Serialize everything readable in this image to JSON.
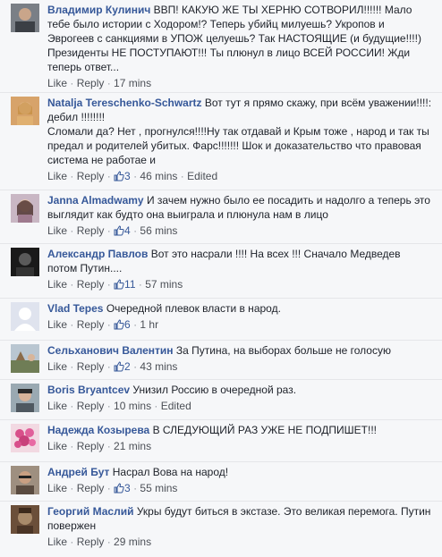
{
  "labels": {
    "like": "Like",
    "reply": "Reply",
    "sep": " · "
  },
  "colors": {
    "link": "#365899",
    "meta": "#90949c",
    "text": "#1d2129",
    "bg": "#f6f7f9"
  },
  "comments": [
    {
      "author": "Владимир Кулинич",
      "text": "ВВП! КАКУЮ ЖЕ ТЫ ХЕРНЮ СОТВОРИЛ!!!!!! Мало тебе было истории с Ходором!? Теперь убийц милуешь? Укропов и Эврогеев с санкциями в УПОЖ целуешь? Так НАСТОЯЩИЕ (и будущие!!!!) Президенты НЕ ПОСТУПАЮТ!!! Ты плюнул в лицо ВСЕЙ РОССИИ! Жди теперь ответ...",
      "likes": "",
      "time": "17 mins",
      "edited": "",
      "avatar_icon": "user-photo-icon"
    },
    {
      "author": "Natalja Tereschenko-Schwartz",
      "text": "Вот тут я прямо скажу, при всём уважении!!!!: дебил !!!!!!!!\nСломали да? Нет , прогнулся!!!!Ну так отдавай и Крым тоже , народ и так ты предал и родителей убитых. Фарс!!!!!!! Шок и доказательство что правовая система не работае и",
      "likes": "3",
      "time": "46 mins",
      "edited": "Edited",
      "avatar_icon": "user-photo-icon"
    },
    {
      "author": "Janna Almadwamy",
      "text": "И зачем нужно было ее посадить и надолго а теперь это выглядит как будто она выиграла и плюнула нам в лицо",
      "likes": "4",
      "time": "56 mins",
      "edited": "",
      "avatar_icon": "user-photo-icon"
    },
    {
      "author": "Александр Павлов",
      "text": "Вот это насрали !!!! На всех !!! Сначало Медведев потом Путин....",
      "likes": "11",
      "time": "57 mins",
      "edited": "",
      "avatar_icon": "user-photo-icon"
    },
    {
      "author": "Vlad Tepes",
      "text": "Очередной плевок власти в народ.",
      "likes": "6",
      "time": "1 hr",
      "edited": "",
      "avatar_icon": "default-avatar-icon"
    },
    {
      "author": "Сельханович Валентин",
      "text": "За Путина, на выборах больше не голосую",
      "likes": "2",
      "time": "43 mins",
      "edited": "",
      "avatar_icon": "user-photo-icon"
    },
    {
      "author": "Boris Bryantcev",
      "text": "Унизил Россию в очередной раз.",
      "likes": "",
      "time": "10 mins",
      "edited": "Edited",
      "avatar_icon": "user-photo-icon"
    },
    {
      "author": "Надежда Козырева",
      "text": "В СЛЕДУЮЩИЙ РАЗ УЖЕ НЕ ПОДПИШЕТ!!!",
      "likes": "",
      "time": "21 mins",
      "edited": "",
      "avatar_icon": "flowers-icon"
    },
    {
      "author": "Андрей Бут",
      "text": "Насрал Вова на народ!",
      "likes": "3",
      "time": "55 mins",
      "edited": "",
      "avatar_icon": "user-photo-icon"
    },
    {
      "author": "Георгий Маслий",
      "text": "Укры будут биться в экстазе. Это великая перемога. Путин повержен",
      "likes": "",
      "time": "29 mins",
      "edited": "",
      "avatar_icon": "user-photo-icon"
    }
  ]
}
